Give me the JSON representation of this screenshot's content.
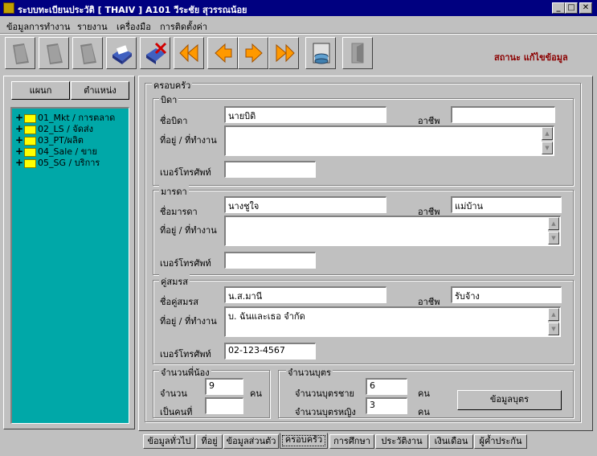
{
  "window": {
    "title": "ระบบทะเบียนประวัติ [ THAIV ]   A101   วีระชัย  สุวรรณน้อย"
  },
  "menu": [
    "ข้อมูลการทำงาน",
    "รายงาน",
    "เครื่องมือ",
    "การติดตั้งค่า"
  ],
  "status_text": "สถานะ แก้ไขข้อมูล",
  "left": {
    "buttons": [
      "แผนก",
      "ตำแหน่ง"
    ],
    "tree": [
      "01_Mkt / การตลาด",
      "02_LS / จัดส่ง",
      "03_PT/ผลิต",
      "04_Sale / ขาย",
      "05_SG / บริการ"
    ]
  },
  "family": {
    "title": "ครอบครัว",
    "father": {
      "title": "บิดา",
      "name_label": "ชื่อบิดา",
      "name": "นายบิดิ",
      "job_label": "อาชีพ",
      "job": "",
      "address_label": "ที่อยู่ / ที่ทำงาน",
      "address": "",
      "phone_label": "เบอร์โทรศัพท์",
      "phone": ""
    },
    "mother": {
      "title": "มารดา",
      "name_label": "ชื่อมารดา",
      "name": "นางชูใจ",
      "job_label": "อาชีพ",
      "job": "แม่บ้าน",
      "address_label": "ที่อยู่ / ที่ทำงาน",
      "address": "",
      "phone_label": "เบอร์โทรศัพท์",
      "phone": ""
    },
    "spouse": {
      "title": "คู่สมรส",
      "name_label": "ชื่อคู่สมรส",
      "name": "น.ส.มานี",
      "job_label": "อาชีพ",
      "job": "รับจ้าง",
      "address_label": "ที่อยู่ / ที่ทำงาน",
      "address": "บ. ฉันและเธอ จำกัด",
      "phone_label": "เบอร์โทรศัพท์",
      "phone": "02-123-4567"
    },
    "siblings": {
      "title": "จำนวนพี่น้อง",
      "count_label": "จำนวน",
      "count": "9",
      "count_unit": "คน",
      "order_label": "เป็นคนที่",
      "order": ""
    },
    "children": {
      "title": "จำนวนบุตร",
      "sons_label": "จำนวนบุตรชาย",
      "sons": "6",
      "sons_unit": "คน",
      "daughters_label": "จำนวนบุตรหญิง",
      "daughters": "3",
      "daughters_unit": "คน",
      "button": "ข้อมูลบุตร"
    }
  },
  "tabs": [
    "ข้อมูลทั่วไป",
    "ที่อยู่",
    "ข้อมูลส่วนตัว",
    "ครอบครัว",
    "การศึกษา",
    "ประวัติงาน",
    "เงินเดือน",
    "ผู้ค้ำประกัน"
  ],
  "active_tab": "ครอบครัว",
  "colors": {
    "titlebar": "#000080",
    "tree_bg": "#00a8a8",
    "status": "#8b0000",
    "arrow": "#ff9900"
  }
}
